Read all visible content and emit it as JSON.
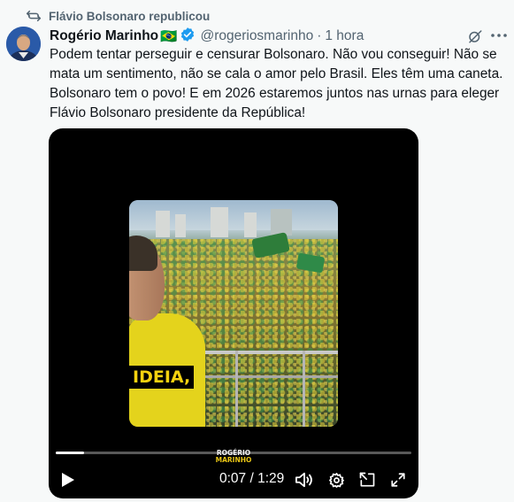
{
  "repost": {
    "label": "Flávio Bolsonaro republicou",
    "icon": "repost-icon"
  },
  "tweet": {
    "author_name": "Rogério Marinho",
    "flag_emoji": "🇧🇷",
    "handle": "@rogeriosmarinho",
    "separator": "·",
    "time": "1 hora",
    "text_lines": [
      "Podem tentar perseguir e censurar Bolsonaro. Não vou conseguir! Não se",
      "mata um sentimento, não se cala o amor pelo Brasil. Eles têm uma caneta.",
      "Bolsonaro tem o povo! E em 2026 estaremos juntos nas urnas para eleger",
      "Flávio Bolsonaro presidente da República!"
    ]
  },
  "video": {
    "caption": "IDEIA,",
    "watermark_line1": "ROGÉRIO",
    "watermark_line2": "MARINHO",
    "current_time": "0:07",
    "time_separator": "/",
    "duration": "1:29",
    "progress": 0.079
  },
  "colors": {
    "background": "#f7f9f9",
    "text": "#0f1419",
    "secondary": "#536471",
    "verified": "#1d9bf0",
    "caption": "#f5d20f"
  },
  "icons": [
    "repost-icon",
    "verified-badge-icon",
    "grok-icon",
    "more-icon",
    "play-icon",
    "volume-icon",
    "settings-icon",
    "pip-icon",
    "fullscreen-icon"
  ]
}
